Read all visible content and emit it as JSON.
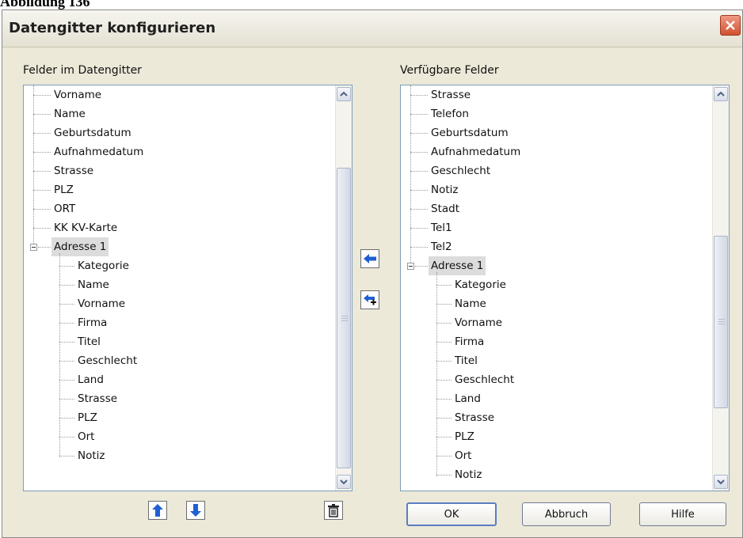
{
  "caption": "Abbildung 136",
  "window": {
    "title": "Datengitter konfigurieren",
    "close_icon": "close-x-icon"
  },
  "left_panel": {
    "label": "Felder im Datengitter",
    "items": [
      "Vorname",
      "Name",
      "Geburtsdatum",
      "Aufnahmedatum",
      "Strasse",
      "PLZ",
      "ORT",
      "KK KV-Karte"
    ],
    "group": {
      "label": "Adresse 1",
      "selected": true,
      "expanded": true,
      "children": [
        "Kategorie",
        "Name",
        "Vorname",
        "Firma",
        "Titel",
        "Geschlecht",
        "Land",
        "Strasse",
        "PLZ",
        "Ort",
        "Notiz"
      ]
    }
  },
  "right_panel": {
    "label": "Verfügbare Felder",
    "items": [
      "Strasse",
      "Telefon",
      "Geburtsdatum",
      "Aufnahmedatum",
      "Geschlecht",
      "Notiz",
      "Stadt",
      "Tel1",
      "Tel2"
    ],
    "group": {
      "label": "Adresse 1",
      "selected": true,
      "expanded": true,
      "children": [
        "Kategorie",
        "Name",
        "Vorname",
        "Firma",
        "Titel",
        "Geschlecht",
        "Land",
        "Strasse",
        "PLZ",
        "Ort",
        "Notiz"
      ]
    }
  },
  "transfer_buttons": {
    "add": "arrow-left-icon",
    "add_with_plus": "arrow-left-plus-icon"
  },
  "order_buttons": {
    "up": "arrow-up-icon",
    "down": "arrow-down-icon",
    "delete": "trash-icon"
  },
  "buttons": {
    "ok": "OK",
    "cancel": "Abbruch",
    "help": "Hilfe"
  },
  "colors": {
    "dialog_bg": "#ece9d8",
    "close_red": "#d2502f",
    "arrow_blue": "#1f5fd0",
    "selection_bg": "#dcdcdc"
  }
}
